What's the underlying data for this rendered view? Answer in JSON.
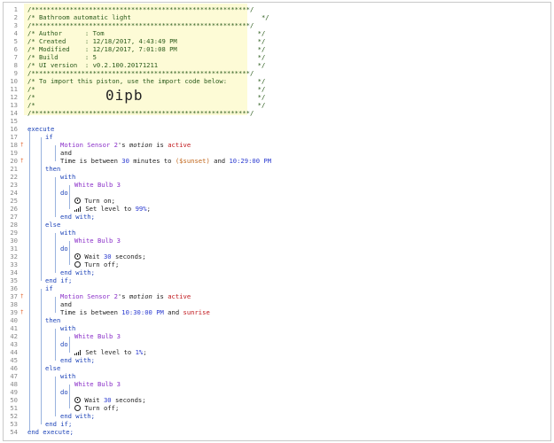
{
  "header": {
    "border": "/*********************************************************/",
    "title": "/* Bathroom automatic light                                  */",
    "author": "/* Author      : Tom                                        */",
    "created": "/* Created     : 12/18/2017, 4:43:49 PM                     */",
    "modified": "/* Modified    : 12/18/2017, 7:01:08 PM                     */",
    "build": "/* Build       : 5                                          */",
    "ui_version": "/* UI version  : v0.2.100.20171211                          */",
    "import_note": "/* To import this piston, use the import code below:        */",
    "blank": "/*                                                          */",
    "import_code": "0ipb"
  },
  "line_numbers": [
    "1",
    "2",
    "3",
    "4",
    "5",
    "6",
    "7",
    "8",
    "9",
    "10",
    "11",
    "12",
    "13",
    "14",
    "15",
    "16",
    "17",
    "18",
    "19",
    "20",
    "21",
    "22",
    "23",
    "24",
    "25",
    "26",
    "27",
    "28",
    "29",
    "30",
    "31",
    "32",
    "33",
    "34",
    "35",
    "36",
    "37",
    "38",
    "39",
    "40",
    "41",
    "42",
    "43",
    "44",
    "45",
    "46",
    "47",
    "48",
    "49",
    "50",
    "51",
    "52",
    "53",
    "54"
  ],
  "condition_markers": {
    "18": "†",
    "20": "†",
    "37": "†",
    "39": "†"
  },
  "code": {
    "execute": "execute",
    "if": "if",
    "and": "and",
    "then": "then",
    "with": "with",
    "do": "do",
    "else": "else",
    "end_with": "end with;",
    "end_if": "end if;",
    "end_execute": "end execute;",
    "motion_device": "Motion Sensor 2",
    "motion_attr_prefix": "'s ",
    "motion_attr": "motion",
    "is": " is ",
    "active": "active",
    "time_prefix": "Time",
    "is_between": " is between ",
    "thirty": "30",
    "minutes_to": " minutes to ",
    "sunset_var": "($sunset)",
    "and_word": " and ",
    "time_1029": "10:29:00 PM",
    "time_1030": "10:30:00 PM",
    "sunrise": "sunrise",
    "bulb": "White Bulb 3",
    "turn_on": "Turn on;",
    "set_level": "Set level to ",
    "level_99": "99%",
    "level_1": "1%",
    "semicolon": ";",
    "wait": "Wait ",
    "seconds": " seconds;",
    "turn_off": "Turn off;"
  }
}
